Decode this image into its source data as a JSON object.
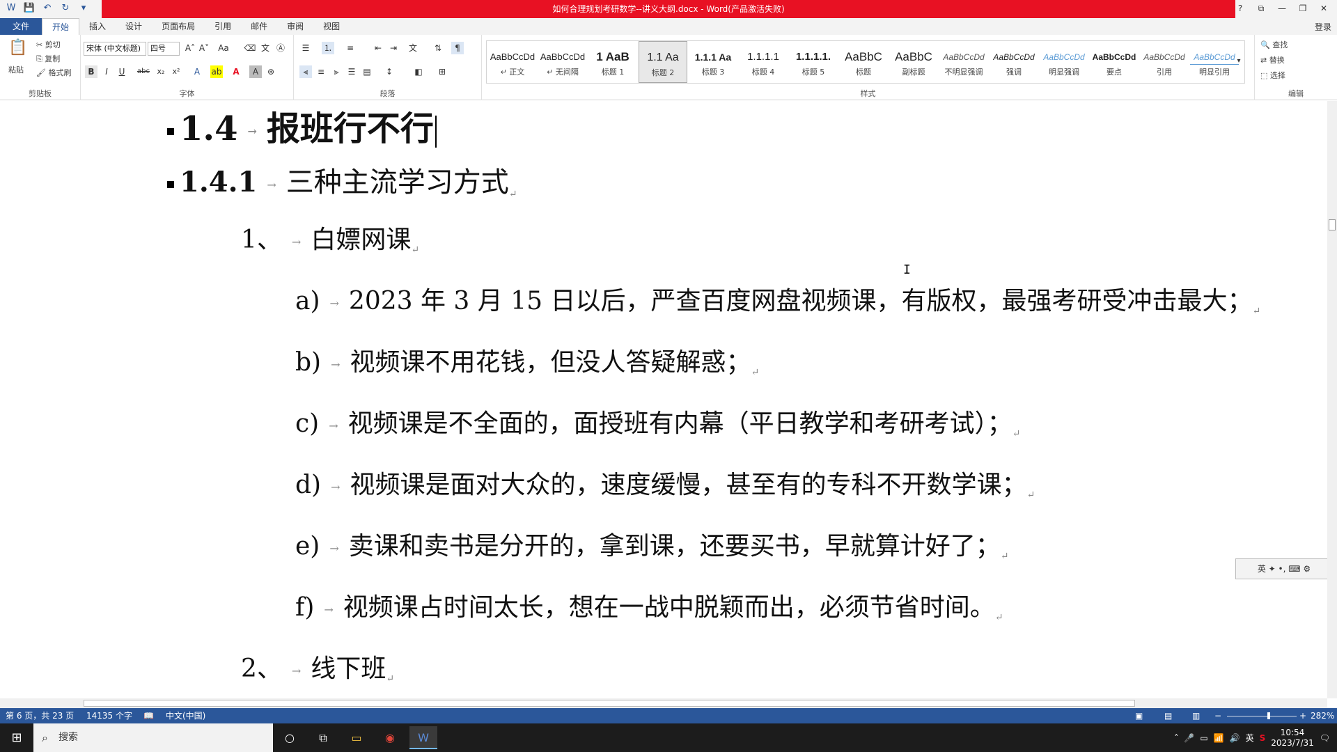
{
  "window": {
    "title": "如何合理规划考研数学--讲义大纲.docx - Word(产品激活失败)",
    "controls": [
      "?",
      "⧉",
      "—",
      "❐",
      "✕"
    ]
  },
  "qat": {
    "word": "W",
    "save": "💾",
    "undo": "↶",
    "redo": "↻",
    "more": "▾"
  },
  "tabs": [
    "文件",
    "开始",
    "插入",
    "设计",
    "页面布局",
    "引用",
    "邮件",
    "审阅",
    "视图"
  ],
  "active_tab": "开始",
  "login": "登录",
  "ribbon": {
    "clipboard": {
      "paste": "粘贴",
      "cut": "剪切",
      "copy": "复制",
      "format_painter": "格式刷",
      "label": "剪贴板"
    },
    "font": {
      "font_name": "宋体 (中文标题)",
      "font_size": "四号",
      "label": "字体",
      "bold": "B",
      "italic": "I",
      "underline": "U",
      "strike": "abc",
      "sub": "x₂",
      "sup": "x²"
    },
    "paragraph": {
      "label": "段落"
    },
    "styles": {
      "label": "样式",
      "items": [
        {
          "sample": "AaBbCcDd",
          "name": "↵ 正文"
        },
        {
          "sample": "AaBbCcDd",
          "name": "↵ 无间隔"
        },
        {
          "sample": "1  AaB",
          "name": "标题 1"
        },
        {
          "sample": "1.1  Aa",
          "name": "标题 2"
        },
        {
          "sample": "1.1.1  Aa",
          "name": "标题 3"
        },
        {
          "sample": "1.1.1.1",
          "name": "标题 4"
        },
        {
          "sample": "1.1.1.1.",
          "name": "标题 5"
        },
        {
          "sample": "AaBbC",
          "name": "标题"
        },
        {
          "sample": "AaBbC",
          "name": "副标题"
        },
        {
          "sample": "AaBbCcDd",
          "name": "不明显强调"
        },
        {
          "sample": "AaBbCcDd",
          "name": "强调"
        },
        {
          "sample": "AaBbCcDd",
          "name": "明显强调"
        },
        {
          "sample": "AaBbCcDd",
          "name": "要点"
        },
        {
          "sample": "AaBbCcDd",
          "name": "引用"
        },
        {
          "sample": "AaBbCcDd",
          "name": "明显引用"
        }
      ]
    },
    "editing": {
      "find": "查找",
      "replace": "替换",
      "select": "选择",
      "label": "编辑"
    }
  },
  "document": {
    "h1": {
      "number": "1.4",
      "text": "报班行不行"
    },
    "h2": {
      "number": "1.4.1",
      "text": "三种主流学习方式"
    },
    "item1": {
      "number": "1、",
      "text": "白嫖网课"
    },
    "subitems": [
      {
        "label": "a)",
        "text": "2023 年 3 月 15 日以后，严查百度网盘视频课，有版权，最强考研受冲击最大；"
      },
      {
        "label": "b)",
        "text": "视频课不用花钱，但没人答疑解惑；"
      },
      {
        "label": "c)",
        "text": "视频课是不全面的，面授班有内幕（平日教学和考研考试）；"
      },
      {
        "label": "d)",
        "text": "视频课是面对大众的，速度缓慢，甚至有的专科不开数学课；"
      },
      {
        "label": "e)",
        "text": "卖课和卖书是分开的，拿到课，还要买书，早就算计好了；"
      },
      {
        "label": "f)",
        "text": "视频课占时间太长，想在一战中脱颖而出，必须节省时间。"
      }
    ],
    "item2": {
      "number": "2、",
      "text": "线下班"
    }
  },
  "status": {
    "page": "第 6 页，共 23 页",
    "words": "14135 个字",
    "lang": "中文(中国)",
    "zoom": "282%"
  },
  "taskbar": {
    "search_placeholder": "搜索",
    "time": "10:54",
    "date": "2023/7/31",
    "ime_lang": "英"
  },
  "ime_bar": "英 ✦ •, ⌨ ⚙",
  "colors": {
    "title_red": "#e81123",
    "word_blue": "#2b579a"
  }
}
